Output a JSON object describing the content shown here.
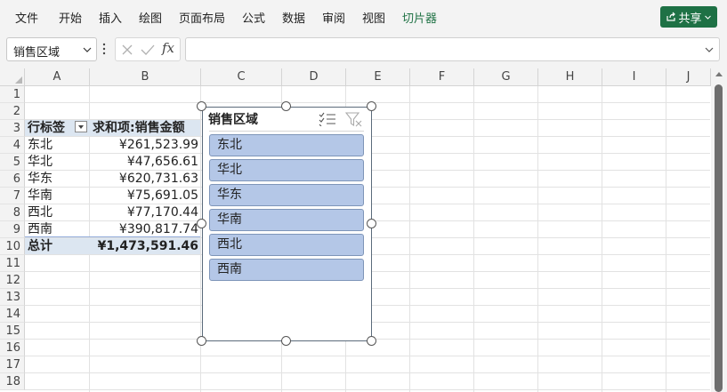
{
  "ribbon": {
    "tabs": [
      {
        "label": "文件"
      },
      {
        "label": "开始"
      },
      {
        "label": "插入"
      },
      {
        "label": "绘图"
      },
      {
        "label": "页面布局"
      },
      {
        "label": "公式"
      },
      {
        "label": "数据"
      },
      {
        "label": "审阅"
      },
      {
        "label": "视图"
      },
      {
        "label": "切片器",
        "active": true
      }
    ],
    "share_label": "共享",
    "accent_color": "#217346"
  },
  "formula_bar": {
    "name_box": "销售区域",
    "fx_label": "fx",
    "formula": ""
  },
  "grid": {
    "columns": [
      "A",
      "B",
      "C",
      "D",
      "E",
      "F",
      "G",
      "H",
      "I",
      "J"
    ],
    "rows": [
      "1",
      "2",
      "3",
      "4",
      "5",
      "6",
      "7",
      "8",
      "9",
      "10",
      "11",
      "12",
      "13",
      "14",
      "15",
      "16",
      "17",
      "18"
    ]
  },
  "pivot": {
    "row_label_header": "行标签",
    "value_header": "求和项:销售金额",
    "rows": [
      {
        "label": "东北",
        "value": "¥261,523.99"
      },
      {
        "label": "华北",
        "value": "¥47,656.61"
      },
      {
        "label": "华东",
        "value": "¥620,731.63"
      },
      {
        "label": "华南",
        "value": "¥75,691.05"
      },
      {
        "label": "西北",
        "value": "¥77,170.44"
      },
      {
        "label": "西南",
        "value": "¥390,817.74"
      }
    ],
    "total_label": "总计",
    "total_value": "¥1,473,591.46",
    "header_fill": "#dce6f1"
  },
  "slicer": {
    "title": "销售区域",
    "items": [
      "东北",
      "华北",
      "华东",
      "华南",
      "西北",
      "西南"
    ],
    "item_fill": "#b4c7e7"
  }
}
